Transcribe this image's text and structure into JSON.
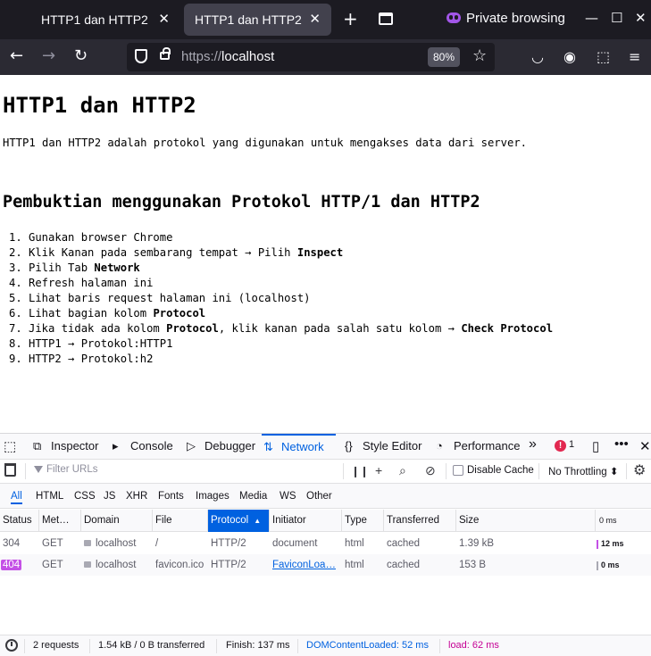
{
  "browser": {
    "tabs": [
      {
        "label": "HTTP1 dan HTTP2",
        "close": "✕"
      },
      {
        "label": "HTTP1 dan HTTP2",
        "close": "✕"
      }
    ],
    "new_tab": "+",
    "private_label": "Private browsing",
    "window_controls": {
      "minimize": "—",
      "maximize": "☐",
      "close": "✕"
    },
    "url_scheme": "https://",
    "url_host": "localhost",
    "zoom": "80%"
  },
  "page": {
    "title": "HTTP1 dan HTTP2",
    "intro": "HTTP1 dan HTTP2 adalah protokol yang digunakan untuk mengakses data dari server.",
    "subtitle": "Pembuktian menggunakan Protokol HTTP/1 dan HTTP2",
    "steps": [
      [
        {
          "t": "1. Gunakan browser Chrome"
        }
      ],
      [
        {
          "t": "2. Klik Kanan pada sembarang tempat → Pilih "
        },
        {
          "t": "Inspect",
          "b": true
        }
      ],
      [
        {
          "t": "3. Pilih Tab "
        },
        {
          "t": "Network",
          "b": true
        }
      ],
      [
        {
          "t": "4. Refresh halaman ini"
        }
      ],
      [
        {
          "t": "5. Lihat baris request halaman ini (localhost)"
        }
      ],
      [
        {
          "t": "6. Lihat bagian kolom "
        },
        {
          "t": "Protocol",
          "b": true
        }
      ],
      [
        {
          "t": "7. Jika tidak ada kolom "
        },
        {
          "t": "Protocol",
          "b": true
        },
        {
          "t": ", klik kanan pada salah satu kolom → "
        },
        {
          "t": "Check Protocol",
          "b": true
        }
      ],
      [
        {
          "t": "8. HTTP1 → Protokol:HTTP1"
        }
      ],
      [
        {
          "t": "9. HTTP2 → Protokol:h2"
        }
      ]
    ]
  },
  "devtools": {
    "tools": [
      {
        "name": "inspector",
        "label": "Inspector",
        "icon": "⧉"
      },
      {
        "name": "console",
        "label": "Console",
        "icon": "▸"
      },
      {
        "name": "debugger",
        "label": "Debugger",
        "icon": "▷"
      },
      {
        "name": "network",
        "label": "Network",
        "icon": "⇅"
      },
      {
        "name": "style-editor",
        "label": "Style Editor",
        "icon": "{}"
      },
      {
        "name": "performance",
        "label": "Performance",
        "icon": "◔"
      }
    ],
    "selected_tool": "network",
    "error_count": "1",
    "filter_placeholder": "Filter URLs",
    "disable_cache": "Disable Cache",
    "throttling": "No Throttling ⬍",
    "type_filters": [
      "All",
      "HTML",
      "CSS",
      "JS",
      "XHR",
      "Fonts",
      "Images",
      "Media",
      "WS",
      "Other"
    ],
    "columns": [
      "Status",
      "Met…",
      "Domain",
      "File",
      "Protocol",
      "Initiator",
      "Type",
      "Transferred",
      "Size",
      "0 ms"
    ],
    "sorted_column": "Protocol",
    "rows": [
      {
        "status": "304",
        "method": "GET",
        "domain": "localhost",
        "file": "/",
        "protocol": "HTTP/2",
        "initiator": "document",
        "type": "html",
        "transferred": "cached",
        "size": "1.39 kB",
        "waterfall": "12 ms"
      },
      {
        "status": "404",
        "method": "GET",
        "domain": "localhost",
        "file": "favicon.ico",
        "protocol": "HTTP/2",
        "initiator": "FaviconLoa…",
        "type": "html",
        "transferred": "cached",
        "size": "153 B",
        "waterfall": "0 ms"
      }
    ],
    "summary": {
      "requests": "2 requests",
      "transferred": "1.54 kB / 0 B transferred",
      "finish": "Finish: 137 ms",
      "domcontentloaded": "DOMContentLoaded: 52 ms",
      "load": "load: 62 ms"
    }
  },
  "colors": {
    "accent": "#0061e0",
    "status_404": "#c451e6",
    "dom_content_loaded": "#0061e0",
    "load": "#c50095"
  }
}
